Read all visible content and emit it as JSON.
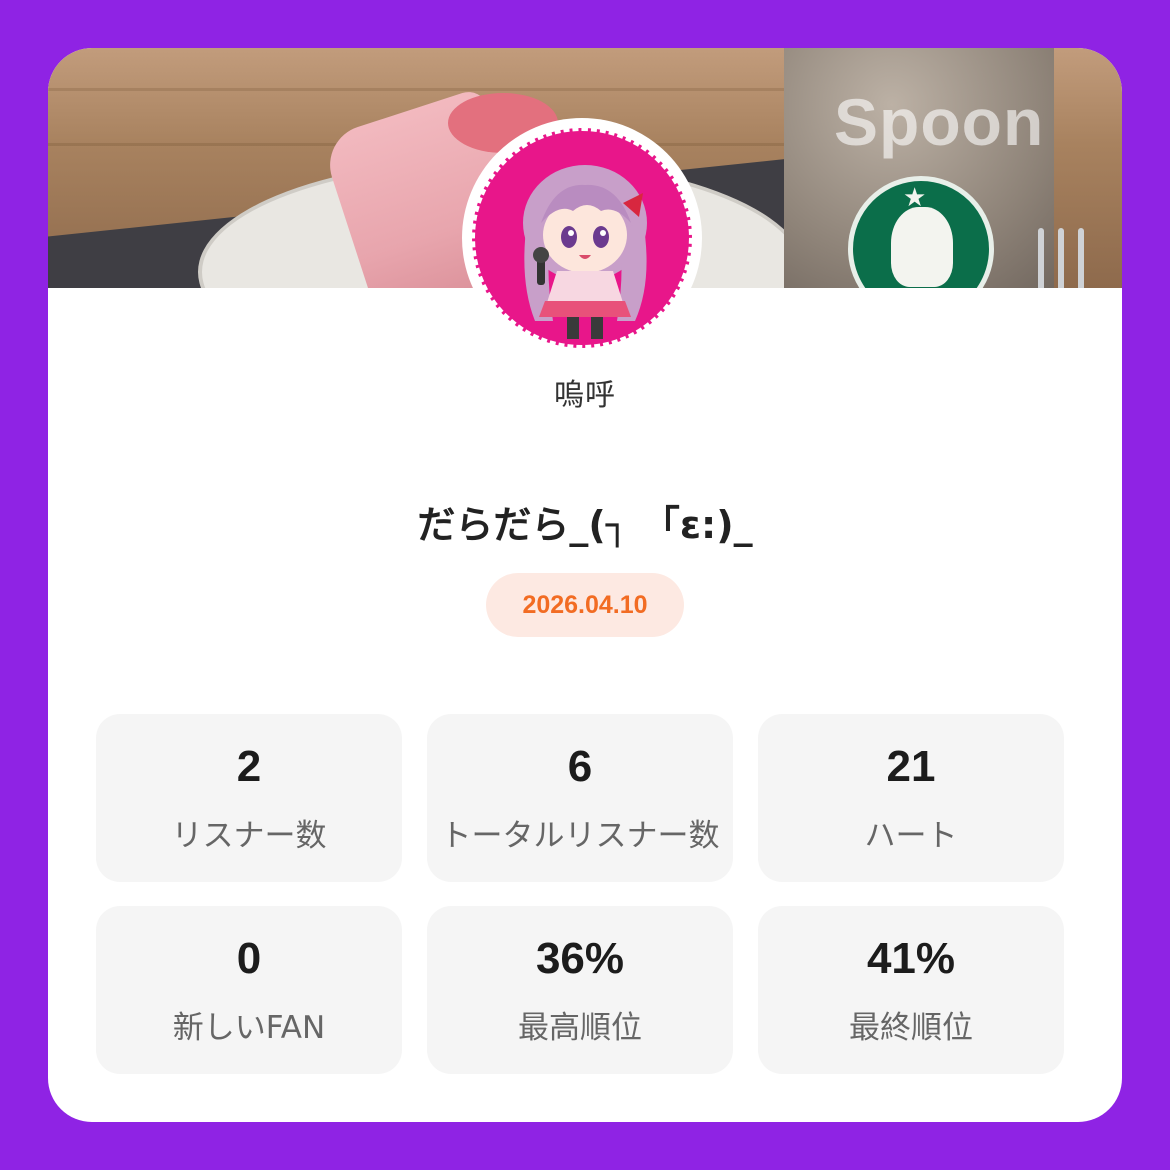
{
  "brand": {
    "logo_text": "Spoon"
  },
  "profile": {
    "username": "嗚呼"
  },
  "broadcast": {
    "title": "だらだら_(┐ 「ε:)_",
    "date": "2026.04.10"
  },
  "stats": [
    {
      "value": "2",
      "label": "リスナー数"
    },
    {
      "value": "6",
      "label": "トータルリスナー数"
    },
    {
      "value": "21",
      "label": "ハート"
    },
    {
      "value": "0",
      "label": "新しいFAN"
    },
    {
      "value": "36%",
      "label": "最高順位"
    },
    {
      "value": "41%",
      "label": "最終順位"
    }
  ],
  "colors": {
    "background": "#8f23e4",
    "avatar_ring": "#e8168a",
    "date_text": "#f26c23",
    "date_pill": "#fde9e2"
  }
}
